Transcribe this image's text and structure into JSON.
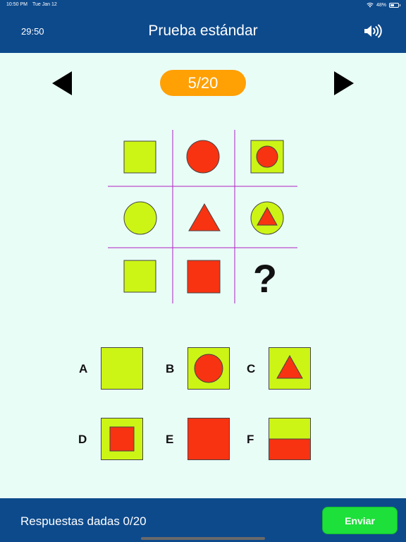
{
  "status_bar": {
    "time": "10:50 PM",
    "date": "Tue Jan 12",
    "battery": "48%"
  },
  "header": {
    "timer": "29:50",
    "title": "Prueba estándar"
  },
  "navigation": {
    "counter": "5/20"
  },
  "puzzle": {
    "missing": "?"
  },
  "options": [
    {
      "letter": "A"
    },
    {
      "letter": "B"
    },
    {
      "letter": "C"
    },
    {
      "letter": "D"
    },
    {
      "letter": "E"
    },
    {
      "letter": "F"
    }
  ],
  "footer": {
    "answered_text": "Respuestas dadas 0/20",
    "send_label": "Enviar"
  },
  "colors": {
    "header": "#0d4a8c",
    "background": "#e9fdf7",
    "lime": "#ccf516",
    "red": "#f73312",
    "counter": "#ffa005",
    "send": "#1de03a",
    "grid_lines": "#b01fc0"
  }
}
